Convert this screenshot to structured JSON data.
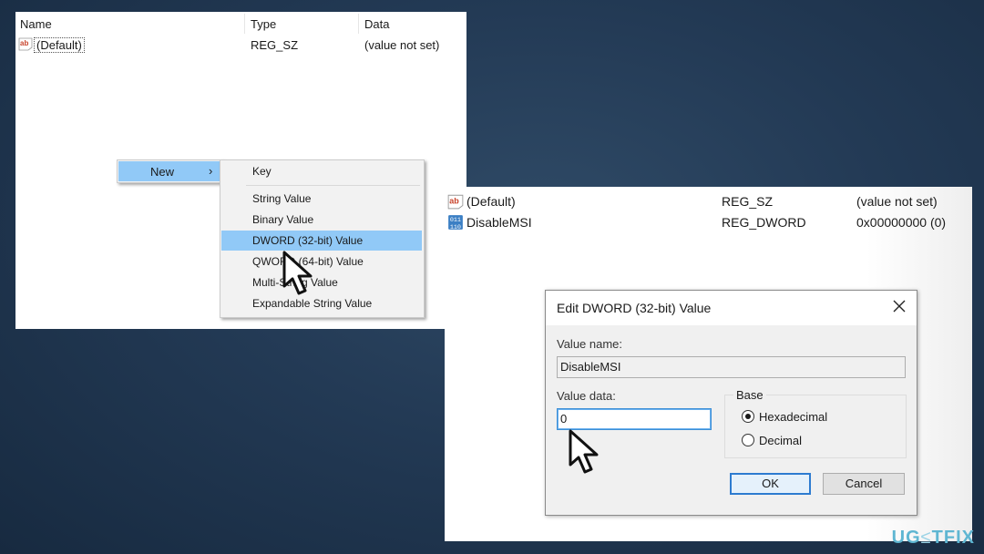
{
  "left_panel": {
    "columns": [
      "Name",
      "Type",
      "Data"
    ],
    "rows": [
      {
        "icon": "string-value-icon",
        "name": "(Default)",
        "type": "REG_SZ",
        "data": "(value not set)"
      }
    ]
  },
  "context_menu": {
    "new_label": "New",
    "arrow": "›",
    "submenu": [
      "Key",
      "String Value",
      "Binary Value",
      "DWORD (32-bit) Value",
      "QWORD (64-bit) Value",
      "Multi-String Value",
      "Expandable String Value"
    ],
    "highlighted": "DWORD (32-bit) Value"
  },
  "right_panel": {
    "rows": [
      {
        "icon": "string-value-icon",
        "name": "(Default)",
        "type": "REG_SZ",
        "data": "(value not set)"
      },
      {
        "icon": "binary-value-icon",
        "name": "DisableMSI",
        "type": "REG_DWORD",
        "data": "0x00000000 (0)"
      }
    ]
  },
  "dialog": {
    "title": "Edit DWORD (32-bit) Value",
    "value_name_label": "Value name:",
    "value_name": "DisableMSI",
    "value_data_label": "Value data:",
    "value_data": "0",
    "base_label": "Base",
    "radio_hex": "Hexadecimal",
    "radio_dec": "Decimal",
    "selected_base": "Hexadecimal",
    "ok_label": "OK",
    "cancel_label": "Cancel"
  },
  "watermark": {
    "prefix": "UG",
    "mid": "≤",
    "suffix": "TFIX"
  },
  "colors": {
    "highlight": "#91c9f7",
    "focus_border": "#2d7bd0",
    "background": "#233a55"
  }
}
